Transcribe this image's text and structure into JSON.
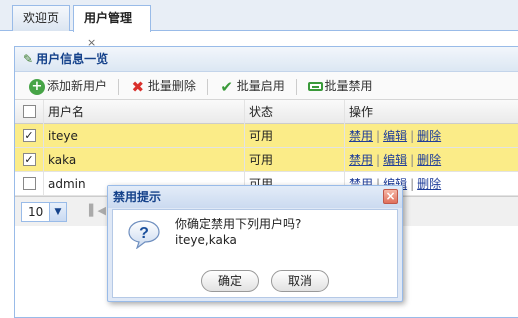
{
  "tabs": [
    {
      "label": "欢迎页"
    },
    {
      "label": "用户管理",
      "close": "×"
    }
  ],
  "panel": {
    "title": "用户信息一览",
    "toolbar": {
      "add": "添加新用户",
      "delete": "批量删除",
      "enable": "批量启用",
      "disable": "批量禁用"
    },
    "columns": [
      "用户名",
      "状态",
      "操作"
    ],
    "rows": [
      {
        "name": "iteye",
        "status": "可用",
        "checked": "✓",
        "actions": [
          "禁用",
          "编辑",
          "删除"
        ]
      },
      {
        "name": "kaka",
        "status": "可用",
        "checked": "✓",
        "actions": [
          "禁用",
          "编辑",
          "删除"
        ]
      },
      {
        "name": "admin",
        "status": "可用",
        "checked": "",
        "actions": [
          "禁用",
          "编辑",
          "删除"
        ]
      }
    ],
    "pager": {
      "page_size": "10"
    }
  },
  "dialog": {
    "title": "禁用提示",
    "close": "×",
    "message": "你确定禁用下列用户吗?",
    "users": "iteye,kaka",
    "ok": "确定",
    "cancel": "取消"
  },
  "colors": {
    "accent": "#99bbe8",
    "title_text": "#15428b",
    "selected_row": "#fbec88"
  }
}
